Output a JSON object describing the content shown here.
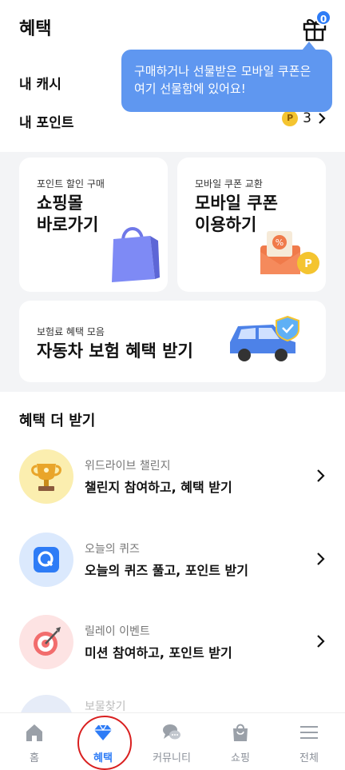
{
  "header": {
    "title": "혜택",
    "gift_badge_count": "0",
    "tooltip": "구매하거나 선물받은 모바일 쿠폰은 여기 선물함에 있어요!",
    "cash_label": "내 캐시",
    "point_label": "내 포인트",
    "point_value": "3",
    "coin_glyph": "P"
  },
  "cards": {
    "shop": {
      "small": "포인트 할인 구매",
      "big": "쇼핑몰\n바로가기"
    },
    "coupon": {
      "small": "모바일 쿠폰 교환",
      "big": "모바일 쿠폰\n이용하기"
    },
    "car": {
      "small": "보험료 혜택 모음",
      "big": "자동차 보험 혜택 받기"
    }
  },
  "more_benefits": {
    "title": "혜택 더 받기",
    "items": [
      {
        "sub": "위드라이브 챌린지",
        "main": "챌린지 참여하고, 혜택 받기",
        "icon": "trophy-icon"
      },
      {
        "sub": "오늘의 퀴즈",
        "main": "오늘의 퀴즈 풀고, 포인트 받기",
        "icon": "quiz-icon"
      },
      {
        "sub": "릴레이 이벤트",
        "main": "미션 참여하고, 포인트 받기",
        "icon": "target-icon"
      },
      {
        "sub": "보물찾기",
        "icon": "treasure-icon"
      }
    ]
  },
  "tabs": [
    {
      "label": "홈",
      "icon": "home-icon"
    },
    {
      "label": "혜택",
      "icon": "benefit-diamond-icon",
      "active": true
    },
    {
      "label": "커뮤니티",
      "icon": "community-chat-icon"
    },
    {
      "label": "쇼핑",
      "icon": "shopping-bag-icon"
    },
    {
      "label": "전체",
      "icon": "menu-icon"
    }
  ],
  "colors": {
    "accent": "#2e7cf6",
    "tooltip": "#5f97f0",
    "highlight": "#d91f1f"
  }
}
